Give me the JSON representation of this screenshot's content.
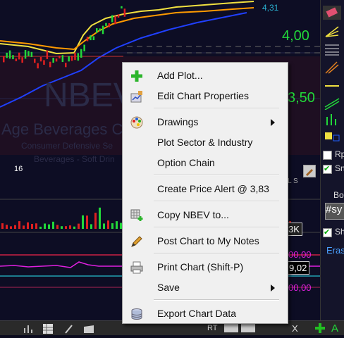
{
  "chart": {
    "symbol_watermark": "NBEV",
    "company_watermark": "Age Beverages C",
    "sector_watermark": "Consumer Defensive Se",
    "industry_watermark": "Beverages - Soft Drin",
    "price_label_top": "4,31",
    "price_tick_400": "4,00",
    "price_tick_350": "3,50",
    "day_label": "16",
    "volume_tag": "3K",
    "indicator_tag_1": "00,00",
    "indicator_tag_2": "9,02",
    "indicator_tag_3": "00,00",
    "axis_letters": "L S",
    "colors": {
      "up": "#22d83a",
      "down": "#e02020",
      "ma_yellow": "#f0e040",
      "ma_orange": "#ff9a00",
      "ma_blue": "#2040ff"
    }
  },
  "right_panel": {
    "checkbox_1_label": "Rp",
    "checkbox_2_label": "Sn",
    "box_label": "Bo",
    "input_value": "#sy",
    "checkbox_3_label": "Sh",
    "erase_label": "Eras"
  },
  "bottom_bar": {
    "rt_label": "RT",
    "a_label": "A",
    "x_label": "X"
  },
  "context_menu": {
    "items": [
      {
        "label": "Add Plot...",
        "icon": "plus-icon"
      },
      {
        "label": "Edit Chart Properties",
        "icon": "chart-properties-icon"
      },
      {
        "label": "Drawings",
        "icon": "palette-icon",
        "submenu": true
      },
      {
        "label": "Plot Sector & Industry"
      },
      {
        "label": "Option Chain"
      },
      {
        "label": "Create Price Alert @ 3,83"
      },
      {
        "label": "Copy NBEV to...",
        "icon": "copy-grid-icon"
      },
      {
        "label": "Post Chart to My Notes",
        "icon": "pencil-icon"
      },
      {
        "label": "Print Chart (Shift-P)",
        "icon": "printer-icon"
      },
      {
        "label": "Save",
        "submenu": true
      },
      {
        "label": "Export Chart Data",
        "icon": "database-icon"
      }
    ]
  }
}
